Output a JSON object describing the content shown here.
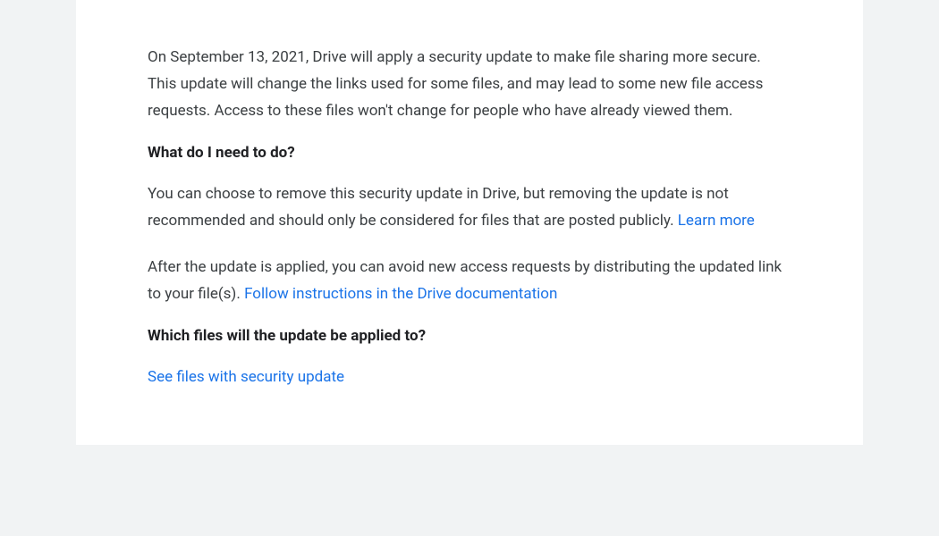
{
  "content": {
    "intro": "On September 13, 2021, Drive will apply a security update to make file sharing more secure. This update will change the links used for some files, and may lead to some new file access requests. Access to these files won't change for people who have already viewed them.",
    "heading1": "What do I need to do?",
    "para2_part1": "You can choose to remove this security update in Drive, but removing the update is not recommended and should only be considered for files that are posted publicly. ",
    "learn_more_link": "Learn more",
    "para3_part1": "After the update is applied, you can avoid new access requests by distributing the updated link to your file(s). ",
    "follow_instructions_link": "Follow instructions in the Drive documentation",
    "heading2": "Which files will the update be applied to?",
    "see_files_link": "See files with security update"
  },
  "colors": {
    "link": "#1a73e8",
    "text": "#3c4043",
    "heading": "#202124",
    "background": "#f1f3f4",
    "card": "#ffffff"
  }
}
